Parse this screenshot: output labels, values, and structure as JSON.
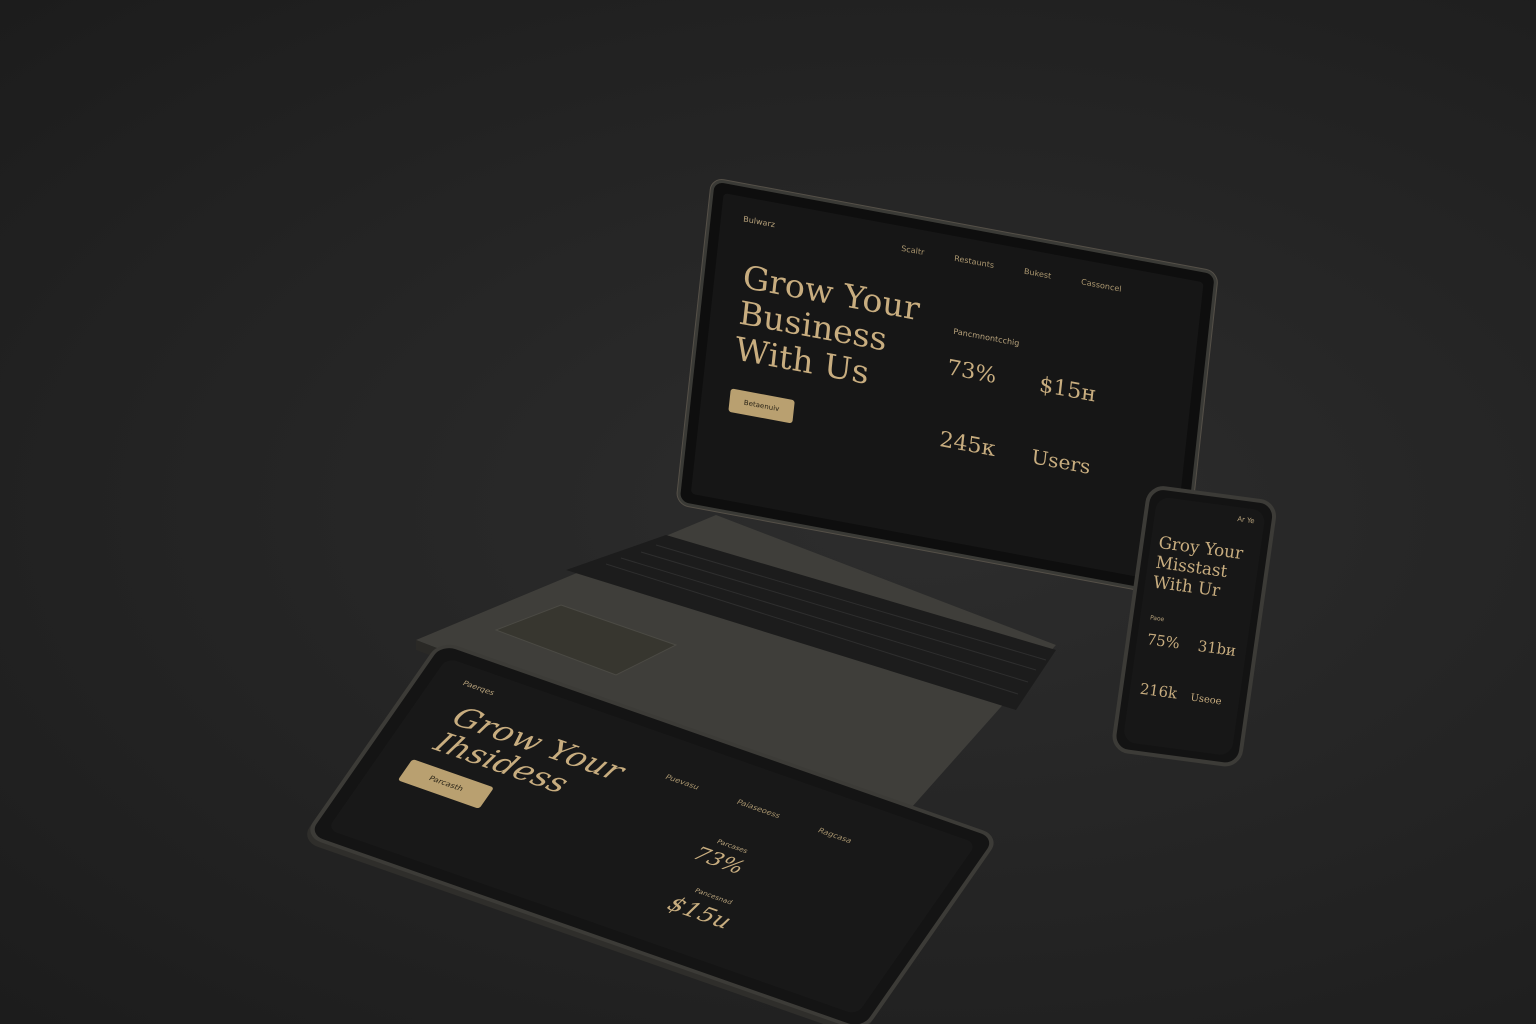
{
  "colors": {
    "background": "#262626",
    "accent_gold": "#c8ad7f",
    "button_gold": "#b9a070",
    "device_frame": "#3c3b37",
    "screen": "#161616"
  },
  "laptop": {
    "brand": "Bulwarz",
    "nav": [
      "Scaltr",
      "Restaunts",
      "Bukest",
      "Cassoncel"
    ],
    "headline": [
      "Grow Your",
      "Business",
      "With Us"
    ],
    "cta_label": "Betaenuiv",
    "stats_label": "Pancmnontcchig",
    "stats": [
      {
        "value": "73%",
        "label": ""
      },
      {
        "value": "$15н",
        "label": ""
      },
      {
        "value": "245к",
        "label": ""
      },
      {
        "value": "Users",
        "label": ""
      }
    ]
  },
  "tablet": {
    "brand": "Paerqes",
    "nav": [
      "Puevasu",
      "Paiaseoess",
      "Ragcasa"
    ],
    "headline": [
      "Grow Your",
      "Ihsidess"
    ],
    "cta_label": "Parcasth",
    "stat1_label": "Parcases",
    "stat1_value": "73%",
    "stat2_label": "Pancesnad",
    "stat2_value": "$15и"
  },
  "phone": {
    "status": "Ar Ye",
    "headline": [
      "Groy Your",
      "Misstast",
      "With Ur"
    ],
    "stat_label": "Paoe",
    "stats": [
      "75%",
      "31bи",
      "216k",
      "Useoe"
    ]
  }
}
